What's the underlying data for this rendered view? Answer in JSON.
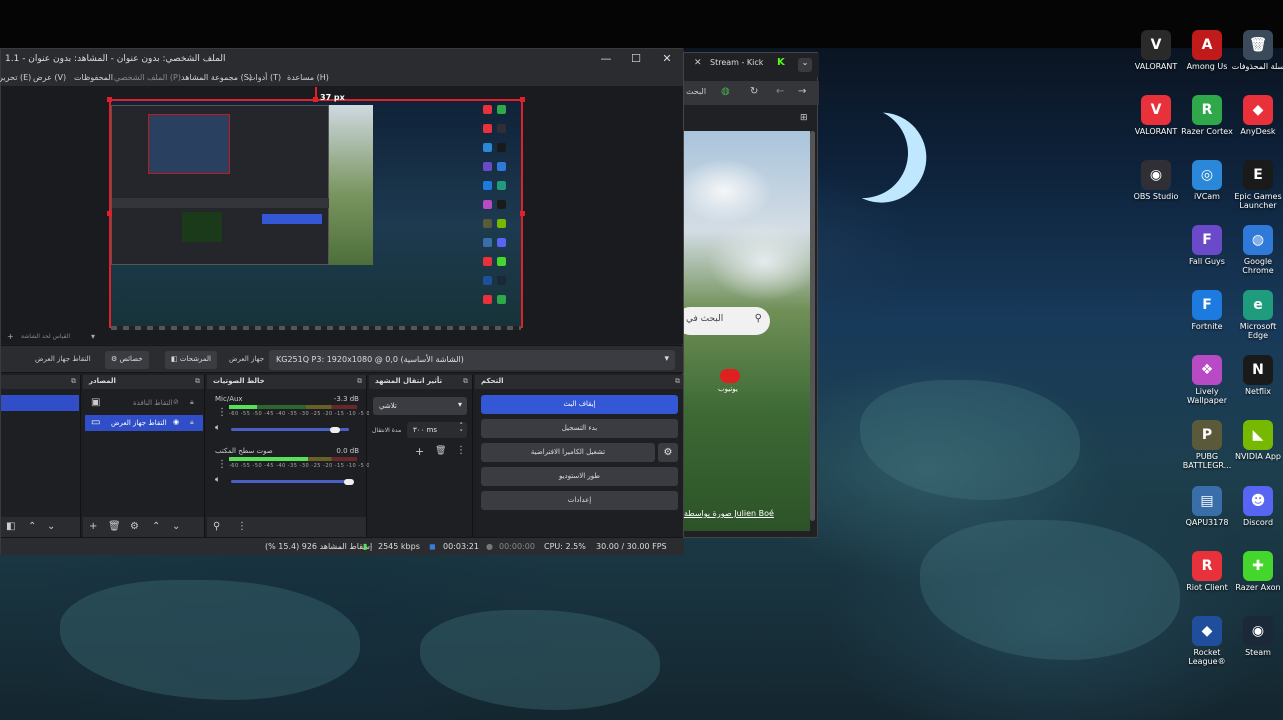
{
  "desktop": {
    "icons": [
      {
        "label": "VALORANT",
        "color": "#2a2a2a",
        "glyph": "V"
      },
      {
        "label": "Among Us",
        "color": "#c01a1a",
        "glyph": "A"
      },
      {
        "label": "سلة المحذوفات",
        "color": "#3a4a5a",
        "glyph": "🗑"
      },
      {
        "label": "VALORANT",
        "color": "#e8313b",
        "glyph": "V"
      },
      {
        "label": "Razer Cortex",
        "color": "#2fa84a",
        "glyph": "R"
      },
      {
        "label": "AnyDesk",
        "color": "#e8313b",
        "glyph": "◆"
      },
      {
        "label": "OBS Studio",
        "color": "#302f35",
        "glyph": "◉"
      },
      {
        "label": "iVCam",
        "color": "#2b88d8",
        "glyph": "◎"
      },
      {
        "label": "Epic Games Launcher",
        "color": "#1a1a1a",
        "glyph": "E"
      },
      {
        "label": "Fall Guys",
        "color": "#6a4ac9",
        "glyph": "F"
      },
      {
        "label": "Google Chrome",
        "color": "#2f7ad8",
        "glyph": "◍"
      },
      {
        "label": "Fortnite",
        "color": "#1d7be0",
        "glyph": "F"
      },
      {
        "label": "Microsoft Edge",
        "color": "#1e9c7d",
        "glyph": "e"
      },
      {
        "label": "Lively Wallpaper",
        "color": "#b84ac6",
        "glyph": "❖"
      },
      {
        "label": "Netflix",
        "color": "#1a1a1a",
        "glyph": "N"
      },
      {
        "label": "PUBG BATTLEGR...",
        "color": "#5a5a3a",
        "glyph": "P"
      },
      {
        "label": "NVIDIA App",
        "color": "#76b900",
        "glyph": "◣"
      },
      {
        "label": "QAPU3178",
        "color": "#3a6ea8",
        "glyph": "▤"
      },
      {
        "label": "Discord",
        "color": "#5865f2",
        "glyph": "☻"
      },
      {
        "label": "Riot Client",
        "color": "#e8313b",
        "glyph": "R"
      },
      {
        "label": "Razer Axon",
        "color": "#44d62c",
        "glyph": "✚"
      },
      {
        "label": "Rocket League®",
        "color": "#1f4f9a",
        "glyph": "◆"
      },
      {
        "label": "Steam",
        "color": "#1b2838",
        "glyph": "◉"
      }
    ]
  },
  "obs": {
    "title": "الملف الشخصي: بدون عنوان - المشاهد: بدون عنوان - 1.1",
    "menu": [
      "مساعدة (H)",
      "أدوات (T)",
      "مجموعة المشاهد (S)",
      "الملف الشخصي (P)",
      "المحفوظات",
      "عرض (V)",
      "تحرير (E)"
    ],
    "preview_px_label": "37 px",
    "scene_row_text": "القياس لحد الشاشة",
    "toolbar": {
      "capture_label": "التقاط جهاز العرض",
      "properties_label": "خصائص",
      "filters_label": "المرشحات",
      "device_label": "جهاز العرض",
      "device_value": "KG251Q P3: 1920x1080 @ 0,0 (الشاشة الأساسية)"
    },
    "docks": {
      "sources_title": "المصادر",
      "mixer_title": "خالط الصوتيات",
      "transitions_title": "تأثير انتقال المشهد",
      "controls_title": "التحكم"
    },
    "sources": [
      {
        "label": "التقاط النافذة"
      },
      {
        "label": "التقاط جهاز العرض"
      }
    ],
    "mixer": [
      {
        "name": "Mic/Aux",
        "db": "-3.3 dB",
        "level": 0.22,
        "volume": 0.88
      },
      {
        "name": "صوت سطح المكتب",
        "db": "0.0 dB",
        "level": 0.62,
        "volume": 1.0
      }
    ],
    "meter_ticks": "-60 -55 -50 -45 -40 -35 -30 -25 -20 -15 -10 -5 0",
    "transitions": {
      "type": "تلاشي",
      "duration_label": "مدة الانتقال",
      "duration_value": "٣٠٠ ms"
    },
    "controls": {
      "stop_stream": "إيقاف البث",
      "start_recording": "بدء التسجيل",
      "virtual_camera": "تشغيل الكاميرا الافتراضية",
      "studio_mode": "طور الاستوديو",
      "settings": "إعدادات"
    },
    "status": {
      "dropped_frames": "إسقاط المشاهد 926 (15.4 %)",
      "bitrate": "2545 kbps",
      "stream_time": "00:03:21",
      "record_time": "00:00:00",
      "cpu": "CPU: 2.5%",
      "fps": "30.00 / 30.00 FPS"
    }
  },
  "browser": {
    "tab_title": "Stream - Kick",
    "address_text": "البحث",
    "search_placeholder": "البحث في",
    "youtube_label": "يوتيوب",
    "credit": "صورة بواسطة Julien Boé"
  },
  "colors": {
    "accent": "#3457d5",
    "record_red": "#e0202a",
    "panel": "#1e1f22"
  }
}
